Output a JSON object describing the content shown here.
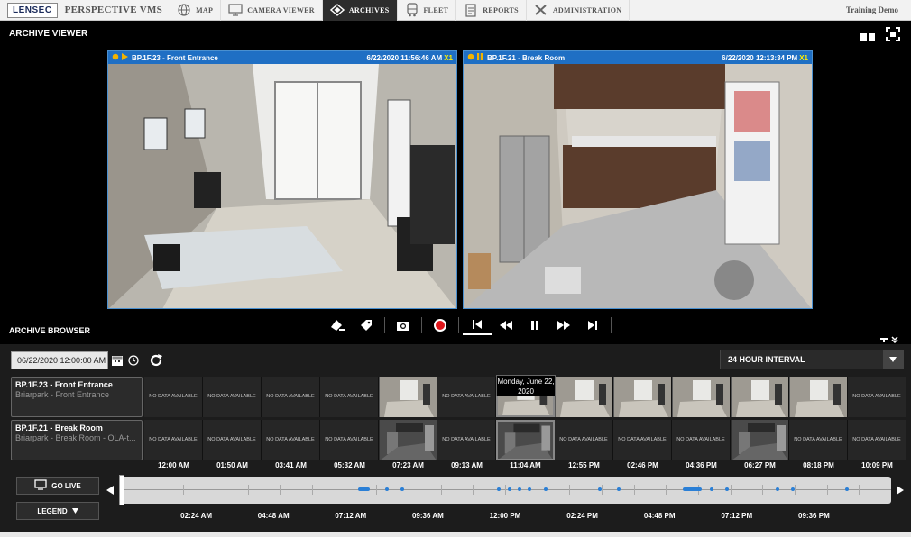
{
  "nav": {
    "logo": "LENSEC",
    "product": "PERSPECTIVE VMS",
    "items": [
      {
        "label": "MAP",
        "icon": "globe-icon",
        "active": false
      },
      {
        "label": "CAMERA VIEWER",
        "icon": "monitor-icon",
        "active": false
      },
      {
        "label": "ARCHIVES",
        "icon": "archive-icon",
        "active": true
      },
      {
        "label": "FLEET",
        "icon": "bus-icon",
        "active": false
      },
      {
        "label": "REPORTS",
        "icon": "report-icon",
        "active": false
      },
      {
        "label": "ADMINISTRATION",
        "icon": "tools-icon",
        "active": false
      }
    ],
    "account": "Training Demo"
  },
  "viewer": {
    "title": "ARCHIVE VIEWER",
    "panes": [
      {
        "camera": "BP.1F.23 - Front Entrance",
        "timestamp": "6/22/2020 11:56:46 AM",
        "speed": "X1",
        "state": "playing"
      },
      {
        "camera": "BP.1F.21 - Break Room",
        "timestamp": "6/22/2020 12:13:34 PM",
        "speed": "X1",
        "state": "paused"
      }
    ]
  },
  "browser": {
    "title": "ARCHIVE BROWSER",
    "date_value": "06/22/2020 12:00:00 AM",
    "interval": "24 HOUR INTERVAL",
    "date_tooltip": "Monday, June 22, 2020",
    "no_data": "NO DATA AVAILABLE",
    "cameras": [
      {
        "name": "BP.1F.23 - Front Entrance",
        "sub": "Briarpark - Front Entrance",
        "cells": [
          "none",
          "none",
          "none",
          "none",
          "thumb",
          "none",
          "thumb",
          "thumb",
          "thumb",
          "thumb",
          "thumb",
          "thumb",
          "none"
        ]
      },
      {
        "name": "BP.1F.21 - Break Room",
        "sub": "Briarpark - Break Room - OLA-t...",
        "cells": [
          "none",
          "none",
          "none",
          "none",
          "thumb",
          "none",
          "thumb",
          "none",
          "none",
          "none",
          "thumb",
          "none",
          "none"
        ]
      }
    ],
    "time_labels": [
      "12:00 AM",
      "01:50 AM",
      "03:41 AM",
      "05:32 AM",
      "07:23 AM",
      "09:13 AM",
      "11:04 AM",
      "12:55 PM",
      "02:46 PM",
      "04:36 PM",
      "06:27 PM",
      "08:18 PM",
      "10:09 PM"
    ],
    "go_live": "GO LIVE",
    "legend": "LEGEND",
    "scrub_labels": [
      "02:24 AM",
      "04:48 AM",
      "07:12 AM",
      "09:36 AM",
      "12:00 PM",
      "02:24 PM",
      "04:48 PM",
      "07:12 PM",
      "09:36 PM"
    ],
    "accent": "#1f6fc4"
  }
}
